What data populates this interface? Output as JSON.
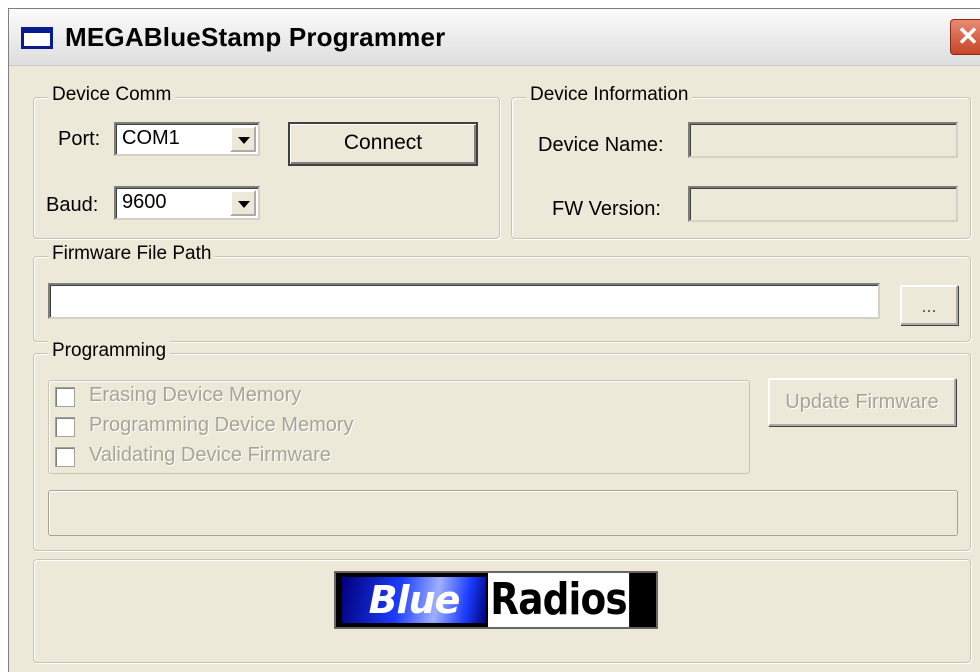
{
  "window": {
    "title": "MEGABlueStamp Programmer",
    "close_glyph": "✕"
  },
  "device_comm": {
    "legend": "Device Comm",
    "port_label": "Port:",
    "port_value": "COM1",
    "baud_label": "Baud:",
    "baud_value": "9600",
    "connect_label": "Connect"
  },
  "device_info": {
    "legend": "Device Information",
    "name_label": "Device Name:",
    "name_value": "",
    "fw_label": "FW Version:",
    "fw_value": ""
  },
  "firmware": {
    "legend": "Firmware File Path",
    "path_value": "",
    "browse_label": "..."
  },
  "programming": {
    "legend": "Programming",
    "steps": [
      {
        "label": "Erasing Device Memory",
        "checked": false
      },
      {
        "label": "Programming Device Memory",
        "checked": false
      },
      {
        "label": "Validating Device Firmware",
        "checked": false
      }
    ],
    "update_label": "Update Firmware",
    "progress": 0
  },
  "logo": {
    "part1": "Blue",
    "part2": "Radios"
  },
  "colors": {
    "face": "#ece9d8",
    "disabled_text": "#a7a497",
    "logo_blue": "#1c3dff"
  }
}
